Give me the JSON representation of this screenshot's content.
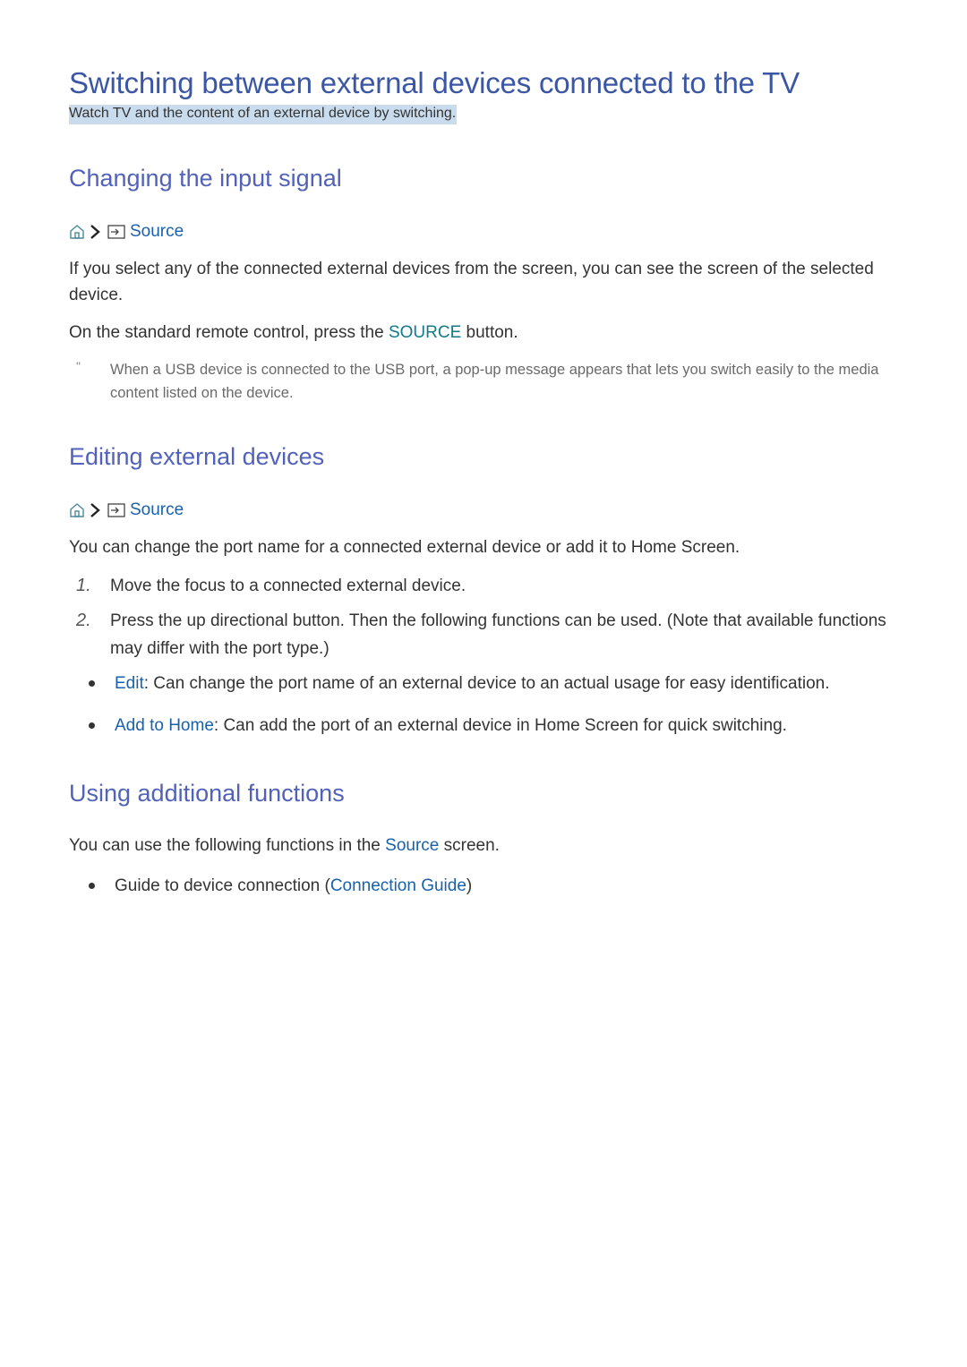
{
  "title": "Switching between external devices connected to the TV",
  "subtitle": "Watch TV and the content of an external device by switching.",
  "sections": [
    {
      "heading": "Changing the input signal",
      "breadcrumb": {
        "home_icon": "home-icon",
        "separator_icon": "chevron-right-icon",
        "source_icon": "source-input-icon",
        "label": "Source"
      },
      "para1": "If you select any of the connected external devices from the screen, you can see the screen of the selected device.",
      "para2_before": "On the standard remote control, press the ",
      "para2_key": "SOURCE",
      "para2_after": " button.",
      "note_mark": "\"",
      "note": "When a USB device is connected to the USB port, a pop-up message appears that lets you switch easily to the media content listed on the device."
    },
    {
      "heading": "Editing external devices",
      "breadcrumb": {
        "home_icon": "home-icon",
        "separator_icon": "chevron-right-icon",
        "source_icon": "source-input-icon",
        "label": "Source"
      },
      "para1": "You can change the port name for a connected external device or add it to Home Screen.",
      "steps": [
        {
          "num": "1.",
          "text": "Move the focus to a connected external device."
        },
        {
          "num": "2.",
          "text": "Press the up directional button. Then the following functions can be used. (Note that available functions may differ with the port type.)"
        }
      ],
      "bullets": [
        {
          "term": "Edit",
          "text": ": Can change the port name of an external device to an actual usage for easy identification."
        },
        {
          "term": "Add to Home",
          "text": ": Can add the port of an external device in Home Screen for quick switching."
        }
      ]
    },
    {
      "heading": "Using additional functions",
      "para1_before": "You can use the following functions in the ",
      "para1_link": "Source",
      "para1_after": " screen.",
      "bullets": [
        {
          "before": "Guide to device connection (",
          "link": "Connection Guide",
          "after": ")"
        }
      ]
    }
  ]
}
